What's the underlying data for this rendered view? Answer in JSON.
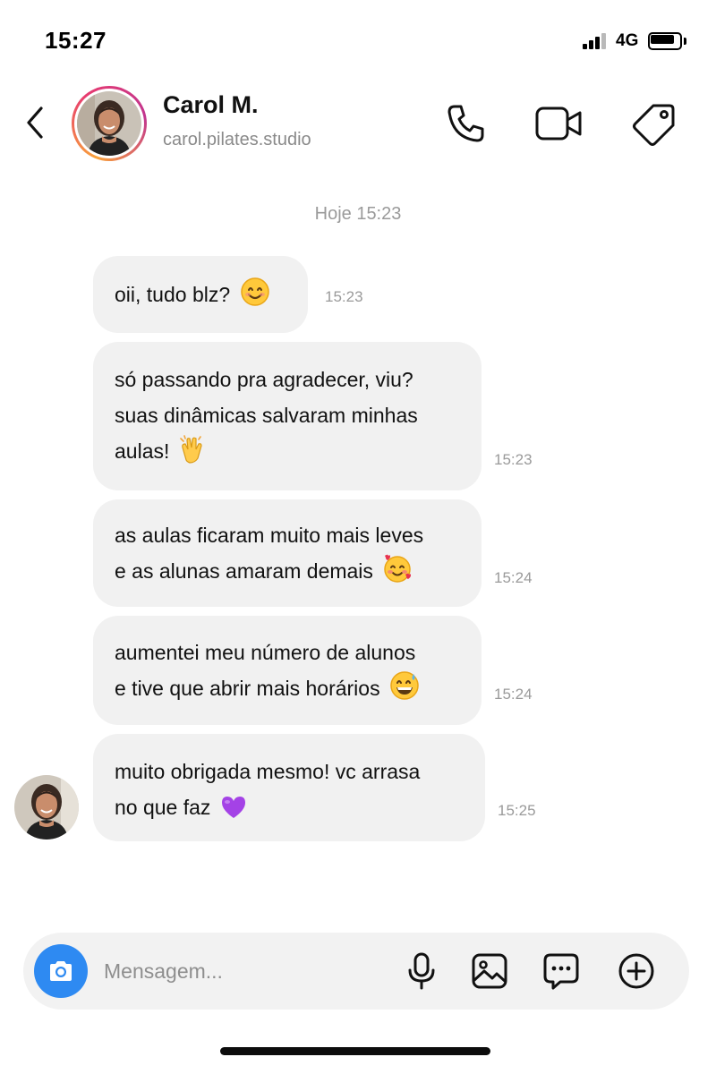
{
  "status_bar": {
    "time": "15:27",
    "network": "4G",
    "icons": [
      "signal-icon",
      "battery-icon"
    ]
  },
  "header": {
    "name": "Carol M.",
    "handle": "carol.pilates.studio",
    "icons": [
      "back-arrow-icon",
      "phone-icon",
      "video-icon",
      "tag-icon"
    ]
  },
  "chat": {
    "date_divider": "Hoje 15:23",
    "messages": [
      {
        "lines": [
          "oii, tudo blz?"
        ],
        "emoji": "smile-emoji",
        "time": "15:23"
      },
      {
        "lines": [
          "só passando pra agradecer, viu?",
          "suas dinâmicas salvaram minhas",
          "aulas!"
        ],
        "emoji": "clapping-hands-emoji",
        "time": "15:23"
      },
      {
        "lines": [
          "as aulas ficaram muito mais leves",
          "e as alunas amaram demais"
        ],
        "emoji": "smiling-face-hearts-emoji",
        "time": "15:24"
      },
      {
        "lines": [
          "aumentei meu número de alunos",
          "e tive que abrir mais horários"
        ],
        "emoji": "grin-sweat-emoji",
        "time": "15:24"
      },
      {
        "lines": [
          "muito obrigada mesmo! vc arrasa",
          "no que faz"
        ],
        "emoji": "purple-heart-emoji",
        "time": "15:25"
      }
    ]
  },
  "composer": {
    "placeholder": "Mensagem...",
    "value": "",
    "icons": [
      "camera-icon",
      "microphone-icon",
      "gallery-icon",
      "sticker-icon",
      "plus-icon"
    ],
    "accent_color": "#2e8af2"
  },
  "colors": {
    "bubble": "#f1f1f1",
    "timestamp": "#9a9a9a",
    "avatar_ring": "#e73b6f"
  }
}
